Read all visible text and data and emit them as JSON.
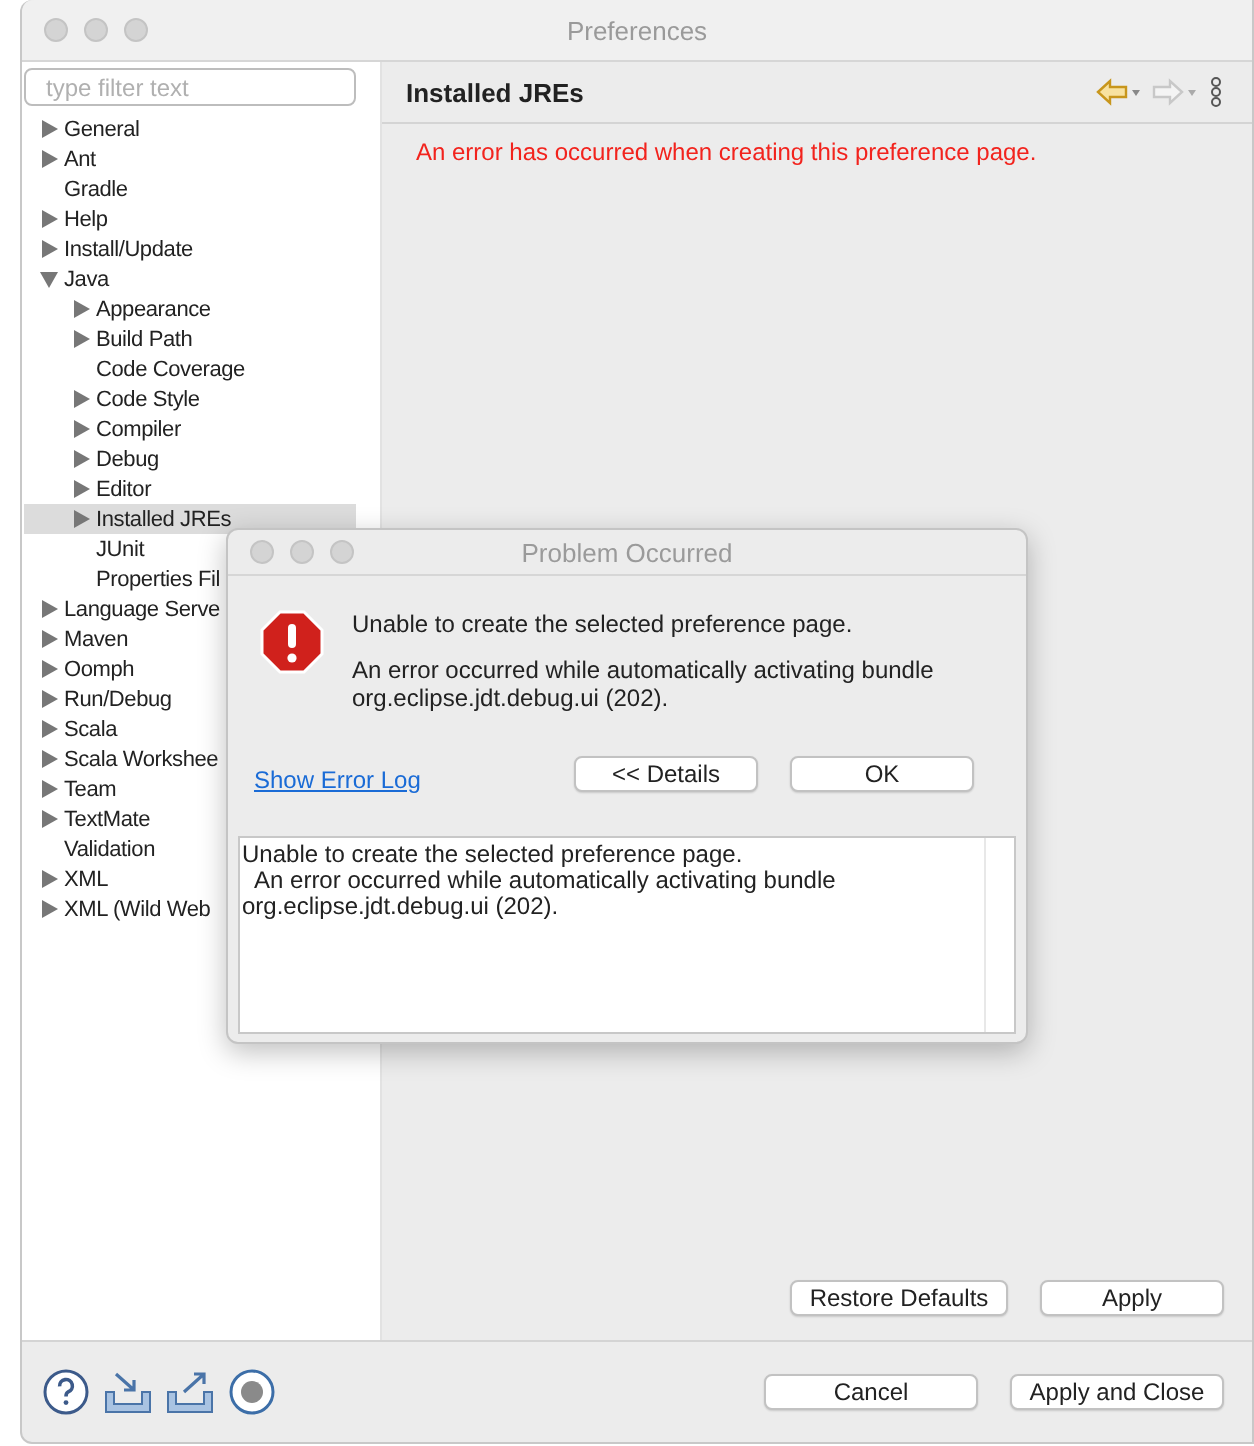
{
  "window": {
    "title": "Preferences"
  },
  "filter": {
    "placeholder": "type filter text"
  },
  "tree": [
    {
      "label": "General",
      "kind": "folder",
      "expanded": false,
      "selected": false
    },
    {
      "label": "Ant",
      "kind": "folder",
      "expanded": false,
      "selected": false
    },
    {
      "label": "Gradle",
      "kind": "leaf",
      "expanded": false,
      "selected": false
    },
    {
      "label": "Help",
      "kind": "folder",
      "expanded": false,
      "selected": false
    },
    {
      "label": "Install/Update",
      "kind": "folder",
      "expanded": false,
      "selected": false
    },
    {
      "label": "Java",
      "kind": "folder",
      "expanded": true,
      "selected": false,
      "children": [
        {
          "label": "Appearance",
          "kind": "folder",
          "expanded": false,
          "selected": false
        },
        {
          "label": "Build Path",
          "kind": "folder",
          "expanded": false,
          "selected": false
        },
        {
          "label": "Code Coverage",
          "kind": "leaf",
          "expanded": false,
          "selected": false
        },
        {
          "label": "Code Style",
          "kind": "folder",
          "expanded": false,
          "selected": false
        },
        {
          "label": "Compiler",
          "kind": "folder",
          "expanded": false,
          "selected": false
        },
        {
          "label": "Debug",
          "kind": "folder",
          "expanded": false,
          "selected": false
        },
        {
          "label": "Editor",
          "kind": "folder",
          "expanded": false,
          "selected": false
        },
        {
          "label": "Installed JREs",
          "kind": "folder",
          "expanded": false,
          "selected": true
        },
        {
          "label": "JUnit",
          "kind": "leaf",
          "expanded": false,
          "selected": false
        },
        {
          "label": "Properties Fil",
          "kind": "leaf",
          "expanded": false,
          "selected": false
        }
      ]
    },
    {
      "label": "Language Serve",
      "kind": "folder",
      "expanded": false,
      "selected": false
    },
    {
      "label": "Maven",
      "kind": "folder",
      "expanded": false,
      "selected": false
    },
    {
      "label": "Oomph",
      "kind": "folder",
      "expanded": false,
      "selected": false
    },
    {
      "label": "Run/Debug",
      "kind": "folder",
      "expanded": false,
      "selected": false
    },
    {
      "label": "Scala",
      "kind": "folder",
      "expanded": false,
      "selected": false
    },
    {
      "label": "Scala Workshee",
      "kind": "folder",
      "expanded": false,
      "selected": false
    },
    {
      "label": "Team",
      "kind": "folder",
      "expanded": false,
      "selected": false
    },
    {
      "label": "TextMate",
      "kind": "folder",
      "expanded": false,
      "selected": false
    },
    {
      "label": "Validation",
      "kind": "leaf",
      "expanded": false,
      "selected": false
    },
    {
      "label": "XML",
      "kind": "folder",
      "expanded": false,
      "selected": false
    },
    {
      "label": "XML (Wild Web",
      "kind": "folder",
      "expanded": false,
      "selected": false
    }
  ],
  "page": {
    "title": "Installed JREs",
    "error": "An error has occurred when creating this preference page.",
    "buttons": [
      "Restore Defaults",
      "Apply"
    ]
  },
  "footer": {
    "buttons": [
      "Cancel",
      "Apply and Close"
    ]
  },
  "dialog": {
    "title": "Problem Occurred",
    "message": "Unable to create the selected preference page.",
    "detail": "An error occurred while automatically activating bundle org.eclipse.jdt.debug.ui (202).",
    "link": "Show Error Log",
    "buttons": [
      "<< Details",
      "OK"
    ],
    "details_lines": [
      "Unable to create the selected preference page.",
      "  An error occurred while automatically activating bundle",
      "org.eclipse.jdt.debug.ui (202)."
    ]
  }
}
